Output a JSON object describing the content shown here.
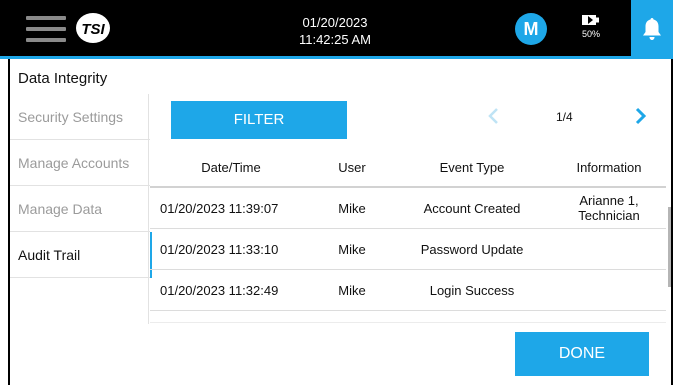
{
  "header": {
    "date": "01/20/2023",
    "time": "11:42:25 AM",
    "user_initial": "M",
    "battery": "50%",
    "accent_color": "#1ea7e8"
  },
  "page": {
    "title": "Data Integrity"
  },
  "sidebar": {
    "items": [
      {
        "label": "Security Settings",
        "active": false
      },
      {
        "label": "Manage Accounts",
        "active": false
      },
      {
        "label": "Manage Data",
        "active": false
      },
      {
        "label": "Audit Trail",
        "active": true
      }
    ]
  },
  "toolbar": {
    "filter_label": "FILTER",
    "page_indicator": "1/4"
  },
  "table": {
    "headers": [
      "Date/Time",
      "User",
      "Event Type",
      "Information"
    ],
    "rows": [
      [
        "01/20/2023 11:39:07",
        "Mike",
        "Account Created",
        "Arianne 1, Technician"
      ],
      [
        "01/20/2023 11:33:10",
        "Mike",
        "Password Update",
        ""
      ],
      [
        "01/20/2023 11:32:49",
        "Mike",
        "Login Success",
        ""
      ]
    ]
  },
  "footer": {
    "done_label": "DONE"
  },
  "icons": [
    "menu-icon",
    "tsi-logo",
    "user-avatar",
    "battery-icon",
    "bell-icon",
    "chevron-left-icon",
    "chevron-right-icon"
  ]
}
